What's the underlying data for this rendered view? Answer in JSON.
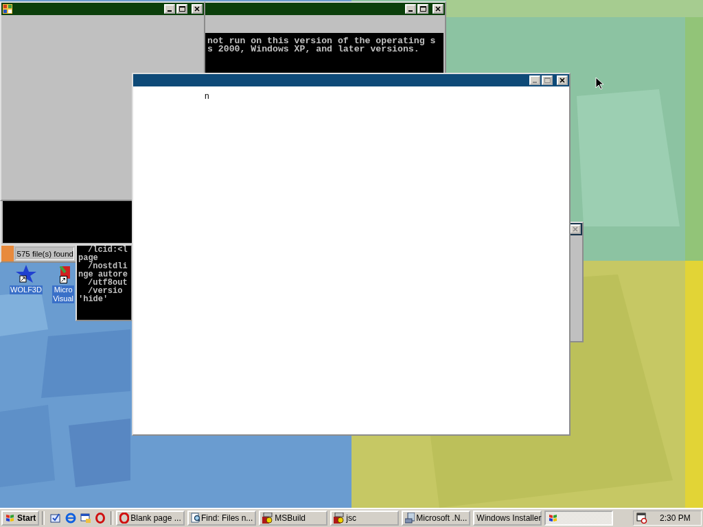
{
  "desktop_icons": [
    {
      "lines": [
        "WOLF3D"
      ]
    },
    {
      "lines": [
        "Micro",
        "Visual"
      ]
    }
  ],
  "console_back": {
    "lines": [
      "not run on this version of the operating s",
      "s 2000, Windows XP, and later versions."
    ]
  },
  "console_small": {
    "lines": [
      {
        "text": "/lcid:<l",
        "kind": "option"
      },
      {
        "text": "page",
        "kind": "text"
      },
      {
        "text": "/nostdli",
        "kind": "option"
      },
      {
        "text": "nge autore",
        "kind": "text"
      },
      {
        "text": "/utf8out",
        "kind": "option"
      },
      {
        "text": "/versio",
        "kind": "option"
      },
      {
        "text": "'hide'",
        "kind": "text"
      }
    ]
  },
  "find_window": {
    "status": "575 file(s) found"
  },
  "front_window": {
    "text": "n",
    "buttons_disabled": true
  },
  "side_window": {
    "close_disabled": true
  },
  "taskbar": {
    "start": "Start",
    "tasks": [
      {
        "label": "Blank page ...",
        "selected": false
      },
      {
        "label": "Find: Files n...",
        "selected": false
      },
      {
        "label": "MSBuild",
        "selected": false
      },
      {
        "label": "jsc",
        "selected": false
      },
      {
        "label": "Microsoft .N...",
        "selected": false
      },
      {
        "label": "Windows Installer",
        "selected": false
      },
      {
        "selected": true
      }
    ],
    "clock": "2:30 PM"
  }
}
